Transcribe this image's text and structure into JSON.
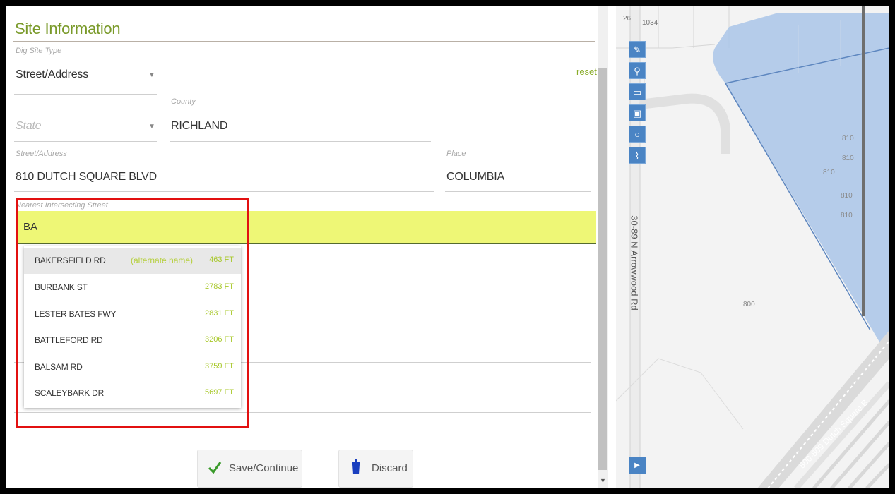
{
  "form": {
    "section_title": "Site Information",
    "reset_label": "reset",
    "dig_site_type": {
      "label": "Dig Site Type",
      "value": "Street/Address"
    },
    "state": {
      "placeholder": "State"
    },
    "county": {
      "label": "County",
      "value": "RICHLAND"
    },
    "street_address": {
      "label": "Street/Address",
      "value": "810 DUTCH SQUARE BLVD"
    },
    "place": {
      "label": "Place",
      "value": "COLUMBIA"
    },
    "nearest_intersecting_street": {
      "label": "Nearest Intersecting Street",
      "value": "BA"
    }
  },
  "suggestions": [
    {
      "name": "BAKERSFIELD RD",
      "note": "(alternate name)",
      "distance": "463 FT"
    },
    {
      "name": "BURBANK ST",
      "note": "",
      "distance": "2783 FT"
    },
    {
      "name": "LESTER BATES FWY",
      "note": "",
      "distance": "2831 FT"
    },
    {
      "name": "BATTLEFORD RD",
      "note": "",
      "distance": "3206 FT"
    },
    {
      "name": "BALSAM RD",
      "note": "",
      "distance": "3759 FT"
    },
    {
      "name": "SCALEYBARK DR",
      "note": "",
      "distance": "5697 FT"
    }
  ],
  "buttons": {
    "save": "Save/Continue",
    "discard": "Discard"
  },
  "map": {
    "parcel_labels": [
      "26",
      "1034",
      "810",
      "810",
      "810",
      "810",
      "810",
      "800"
    ],
    "road_labels": [
      "30-89 N Arrowwood Rd",
      "800-809 Dutch Square B"
    ],
    "tool_icons": [
      "edit-icon",
      "pin-icon",
      "rectangle-icon",
      "square-icon",
      "circle-icon",
      "polyline-icon"
    ]
  },
  "colors": {
    "accent_green": "#7a9a2a",
    "highlight_input": "#eef776",
    "map_parcel": "#a9c4e8",
    "map_tool": "#4a84c4",
    "annotation_red": "#e21010"
  }
}
